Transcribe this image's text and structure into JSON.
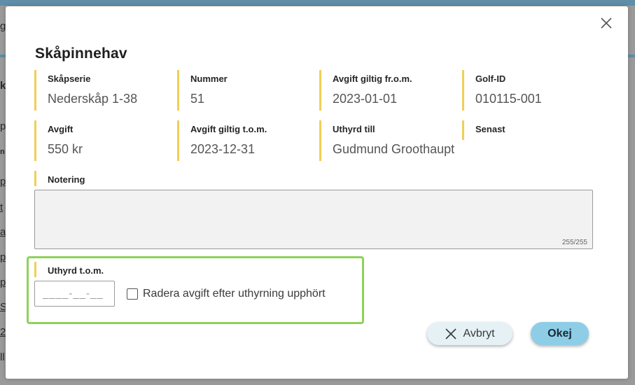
{
  "background": {
    "fragments": [
      "g",
      "k",
      "p",
      "n",
      "p",
      "t",
      "a",
      "p",
      "p",
      "S",
      "2",
      "ll"
    ]
  },
  "dialog": {
    "title": "Skåpinnehav",
    "fields": {
      "series": {
        "label": "Skåpserie",
        "value": "Nederskåp 1-38"
      },
      "number": {
        "label": "Nummer",
        "value": "51"
      },
      "valid_from": {
        "label": "Avgift giltig fr.o.m.",
        "value": "2023-01-01"
      },
      "golf_id": {
        "label": "Golf-ID",
        "value": "010115-001"
      },
      "fee": {
        "label": "Avgift",
        "value": "550 kr"
      },
      "valid_to": {
        "label": "Avgift giltig t.o.m.",
        "value": "2023-12-31"
      },
      "rented_to": {
        "label": "Uthyrd till",
        "value": "Gudmund Groothaupt"
      },
      "latest": {
        "label": "Senast",
        "value": ""
      }
    },
    "notes": {
      "label": "Notering",
      "value": "",
      "counter": "255/255"
    },
    "rental_end": {
      "label": "Uthyrd t.o.m.",
      "placeholder": "____-__-__",
      "checkbox_label": "Radera avgift efter uthyrning upphört",
      "checked": false
    },
    "buttons": {
      "cancel": "Avbryt",
      "ok": "Okej"
    },
    "colors": {
      "accent_border": "#f0cf55",
      "highlight": "#8ed25a",
      "ok_button": "#8ecde6",
      "cancel_button": "#e6f1f6"
    }
  }
}
